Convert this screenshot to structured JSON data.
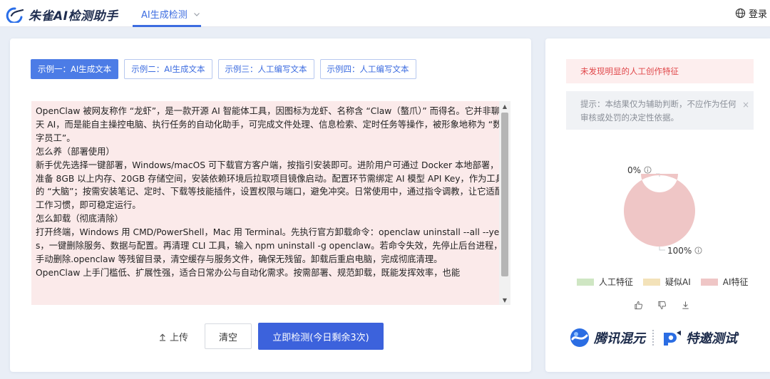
{
  "header": {
    "app_title": "朱雀AI检测助手",
    "active_tab": "AI生成检测",
    "login_label": "登录"
  },
  "examples": [
    {
      "label": "示例一：AI生成文本",
      "active": true
    },
    {
      "label": "示例二：AI生成文本",
      "active": false
    },
    {
      "label": "示例三：人工编写文本",
      "active": false
    },
    {
      "label": "示例四：人工编写文本",
      "active": false
    }
  ],
  "input": {
    "text": "OpenClaw 被网友称作 “龙虾”，是一款开源 AI 智能体工具，因图标为龙虾、名称含 “Claw（螯爪）” 而得名。它并非聊天 AI，而是能自主操控电脑、执行任务的自动化助手，可完成文件处理、信息检索、定时任务等操作，被形象地称为 “数字员工”。\n怎么养（部署使用）\n新手优先选择一键部署，Windows/macOS 可下载官方客户端，按指引安装即可。进阶用户可通过 Docker 本地部署，准备 8GB 以上内存、20GB 存储空间，安装依赖环境后拉取项目镜像启动。配置环节需绑定 AI 模型 API Key，作为工具的 “大脑”；按需安装笔记、定时、下载等技能插件，设置权限与端口，避免冲突。日常使用中，通过指令调教，让它适配工作习惯，即可稳定运行。\n怎么卸载（彻底清除）\n打开终端，Windows 用 CMD/PowerShell，Mac 用 Terminal。先执行官方卸载命令：openclaw uninstall --all --yes，一键删除服务、数据与配置。再清理 CLI 工具，输入 npm uninstall -g openclaw。若命令失效，先停止后台进程，手动删除.openclaw 等残留目录，清空缓存与服务文件，确保无残留。卸载后重启电脑，完成彻底清理。\nOpenClaw 上手门槛低、扩展性强，适合日常办公与自动化需求。按需部署、规范卸载，既能发挥效率，也能"
  },
  "actions": {
    "upload_label": "上传",
    "clear_label": "清空",
    "detect_label": "立即检测(今日剩余3次)"
  },
  "result": {
    "alert_text": "未发现明显的人工创作特征",
    "notice_text": "提示：本结果仅为辅助判断，不应作为任何审核或处罚的决定性依据。",
    "close_symbol": "×",
    "human_percent_label": "0%",
    "ai_percent_label": "100%"
  },
  "chart_data": {
    "type": "pie",
    "categories": [
      "人工特征",
      "疑似AI",
      "AI特征"
    ],
    "values": [
      0,
      0,
      100
    ],
    "colors": [
      "#cfe6c3",
      "#f3e2b9",
      "#efc6c6"
    ],
    "legend_position": "bottom"
  },
  "footer": {
    "brand1": "腾讯混元",
    "brand2": "特邀测试"
  }
}
